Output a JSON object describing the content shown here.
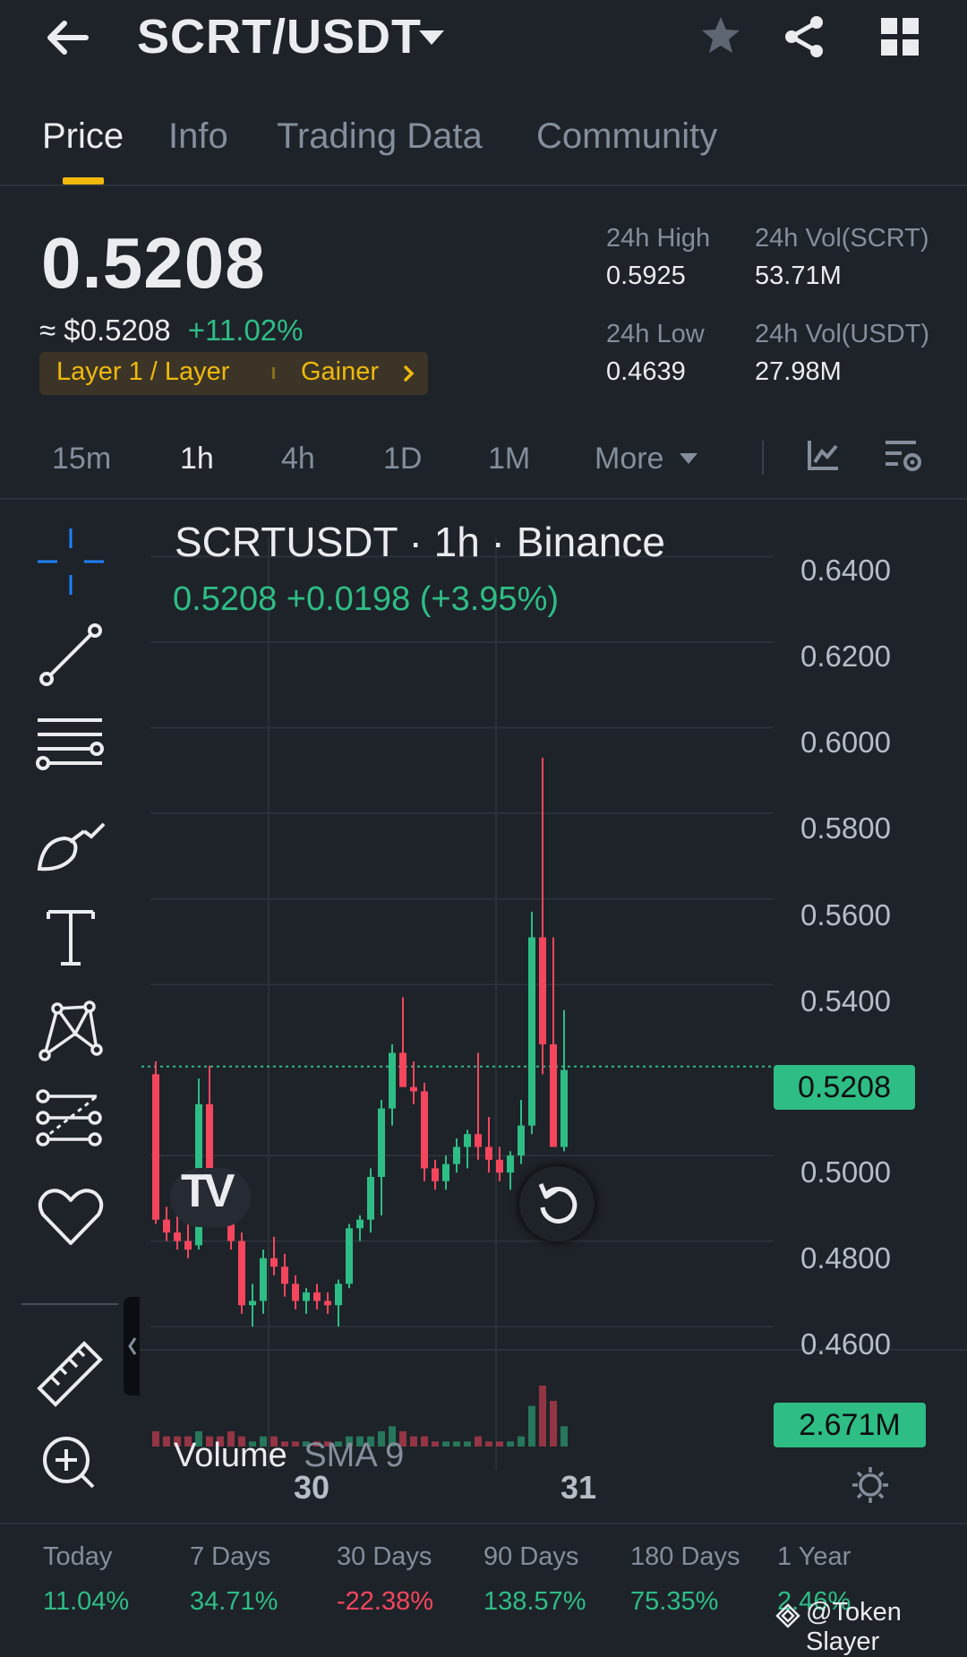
{
  "header": {
    "pair": "SCRT/USDT"
  },
  "tabs": [
    {
      "label": "Price",
      "active": true
    },
    {
      "label": "Info",
      "active": false
    },
    {
      "label": "Trading Data",
      "active": false
    },
    {
      "label": "Community",
      "active": false
    }
  ],
  "ticker": {
    "price": "0.5208",
    "usd_price": "≈ $0.5208",
    "change_24h": "+11.02%",
    "tag_category": "Layer 1 / Layer",
    "tag_gainer": "Gainer",
    "high_label": "24h High",
    "high_value": "0.5925",
    "low_label": "24h Low",
    "low_value": "0.4639",
    "vol_base_label": "24h Vol(SCRT)",
    "vol_base_value": "53.71M",
    "vol_quote_label": "24h Vol(USDT)",
    "vol_quote_value": "27.98M"
  },
  "intervals": [
    {
      "label": "15m",
      "active": false
    },
    {
      "label": "1h",
      "active": true
    },
    {
      "label": "4h",
      "active": false
    },
    {
      "label": "1D",
      "active": false
    },
    {
      "label": "1M",
      "active": false
    },
    {
      "label": "More",
      "active": false
    }
  ],
  "chart": {
    "title": "SCRTUSDT · 1h · Binance",
    "ohlc_summary": "0.5208  +0.0198 (+3.95%)",
    "current_price_badge": "0.5208",
    "volume_label": "Volume",
    "volume_indicator": "SMA 9",
    "volume_badge": "2.671M",
    "logo_text": "TV",
    "y_ticks": [
      "0.6400",
      "0.6200",
      "0.6000",
      "0.5800",
      "0.5600",
      "0.5400",
      "0.5000",
      "0.4800",
      "0.4600"
    ],
    "x_ticks": [
      "30",
      "31"
    ],
    "colors": {
      "up": "#2ebd85",
      "down": "#f6465d",
      "accent": "#f0b90b",
      "grid": "#2b3139"
    }
  },
  "chart_data": {
    "type": "candlestick",
    "ylim": [
      0.455,
      0.6445
    ],
    "last_price": 0.5208,
    "candles": [
      {
        "o": 0.519,
        "h": 0.522,
        "l": 0.484,
        "c": 0.485
      },
      {
        "o": 0.485,
        "h": 0.488,
        "l": 0.48,
        "c": 0.482
      },
      {
        "o": 0.482,
        "h": 0.486,
        "l": 0.478,
        "c": 0.48
      },
      {
        "o": 0.48,
        "h": 0.485,
        "l": 0.476,
        "c": 0.478
      },
      {
        "o": 0.479,
        "h": 0.518,
        "l": 0.478,
        "c": 0.512
      },
      {
        "o": 0.512,
        "h": 0.521,
        "l": 0.49,
        "c": 0.493
      },
      {
        "o": 0.493,
        "h": 0.497,
        "l": 0.485,
        "c": 0.488
      },
      {
        "o": 0.488,
        "h": 0.49,
        "l": 0.478,
        "c": 0.48
      },
      {
        "o": 0.48,
        "h": 0.482,
        "l": 0.463,
        "c": 0.465
      },
      {
        "o": 0.465,
        "h": 0.47,
        "l": 0.46,
        "c": 0.466
      },
      {
        "o": 0.466,
        "h": 0.478,
        "l": 0.463,
        "c": 0.476
      },
      {
        "o": 0.476,
        "h": 0.481,
        "l": 0.472,
        "c": 0.474
      },
      {
        "o": 0.474,
        "h": 0.477,
        "l": 0.467,
        "c": 0.47
      },
      {
        "o": 0.47,
        "h": 0.472,
        "l": 0.464,
        "c": 0.466
      },
      {
        "o": 0.466,
        "h": 0.469,
        "l": 0.463,
        "c": 0.468
      },
      {
        "o": 0.468,
        "h": 0.47,
        "l": 0.464,
        "c": 0.466
      },
      {
        "o": 0.466,
        "h": 0.468,
        "l": 0.463,
        "c": 0.465
      },
      {
        "o": 0.465,
        "h": 0.471,
        "l": 0.46,
        "c": 0.47
      },
      {
        "o": 0.47,
        "h": 0.484,
        "l": 0.469,
        "c": 0.483
      },
      {
        "o": 0.483,
        "h": 0.486,
        "l": 0.48,
        "c": 0.485
      },
      {
        "o": 0.485,
        "h": 0.497,
        "l": 0.482,
        "c": 0.495
      },
      {
        "o": 0.495,
        "h": 0.513,
        "l": 0.486,
        "c": 0.511
      },
      {
        "o": 0.511,
        "h": 0.526,
        "l": 0.507,
        "c": 0.524
      },
      {
        "o": 0.524,
        "h": 0.537,
        "l": 0.517,
        "c": 0.516
      },
      {
        "o": 0.516,
        "h": 0.522,
        "l": 0.512,
        "c": 0.515
      },
      {
        "o": 0.515,
        "h": 0.517,
        "l": 0.494,
        "c": 0.497
      },
      {
        "o": 0.497,
        "h": 0.499,
        "l": 0.492,
        "c": 0.494
      },
      {
        "o": 0.494,
        "h": 0.5,
        "l": 0.492,
        "c": 0.498
      },
      {
        "o": 0.498,
        "h": 0.504,
        "l": 0.496,
        "c": 0.502
      },
      {
        "o": 0.502,
        "h": 0.506,
        "l": 0.497,
        "c": 0.505
      },
      {
        "o": 0.505,
        "h": 0.524,
        "l": 0.499,
        "c": 0.502
      },
      {
        "o": 0.502,
        "h": 0.509,
        "l": 0.496,
        "c": 0.499
      },
      {
        "o": 0.499,
        "h": 0.502,
        "l": 0.494,
        "c": 0.496
      },
      {
        "o": 0.496,
        "h": 0.501,
        "l": 0.492,
        "c": 0.5
      },
      {
        "o": 0.5,
        "h": 0.513,
        "l": 0.498,
        "c": 0.507
      },
      {
        "o": 0.507,
        "h": 0.557,
        "l": 0.505,
        "c": 0.551
      },
      {
        "o": 0.551,
        "h": 0.593,
        "l": 0.519,
        "c": 0.526
      },
      {
        "o": 0.526,
        "h": 0.551,
        "l": 0.502,
        "c": 0.502
      },
      {
        "o": 0.502,
        "h": 0.534,
        "l": 0.501,
        "c": 0.52
      }
    ],
    "volume_series": [
      {
        "name": "Volume",
        "values": [
          3,
          2,
          2,
          2,
          3,
          2,
          2,
          3,
          2,
          1,
          2,
          2,
          1,
          1,
          1,
          1,
          1,
          1,
          2,
          2,
          2,
          3,
          4,
          3,
          2,
          2,
          1,
          1,
          1,
          1,
          2,
          1,
          1,
          1,
          2,
          8,
          12,
          9,
          4
        ]
      }
    ],
    "x_tick_labels": [
      "30",
      "31"
    ],
    "y_tick_labels": [
      "0.6400",
      "0.6200",
      "0.6000",
      "0.5800",
      "0.5600",
      "0.5400",
      "0.5000",
      "0.4800",
      "0.4600"
    ]
  },
  "performance": [
    {
      "label": "Today",
      "value": "11.04%",
      "dir": "pos"
    },
    {
      "label": "7 Days",
      "value": "34.71%",
      "dir": "pos"
    },
    {
      "label": "30 Days",
      "value": "-22.38%",
      "dir": "neg"
    },
    {
      "label": "90 Days",
      "value": "138.57%",
      "dir": "pos"
    },
    {
      "label": "180 Days",
      "value": "75.35%",
      "dir": "pos"
    },
    {
      "label": "1 Year",
      "value": "2.46%",
      "dir": "pos"
    }
  ],
  "watermark": "@Token Slayer"
}
